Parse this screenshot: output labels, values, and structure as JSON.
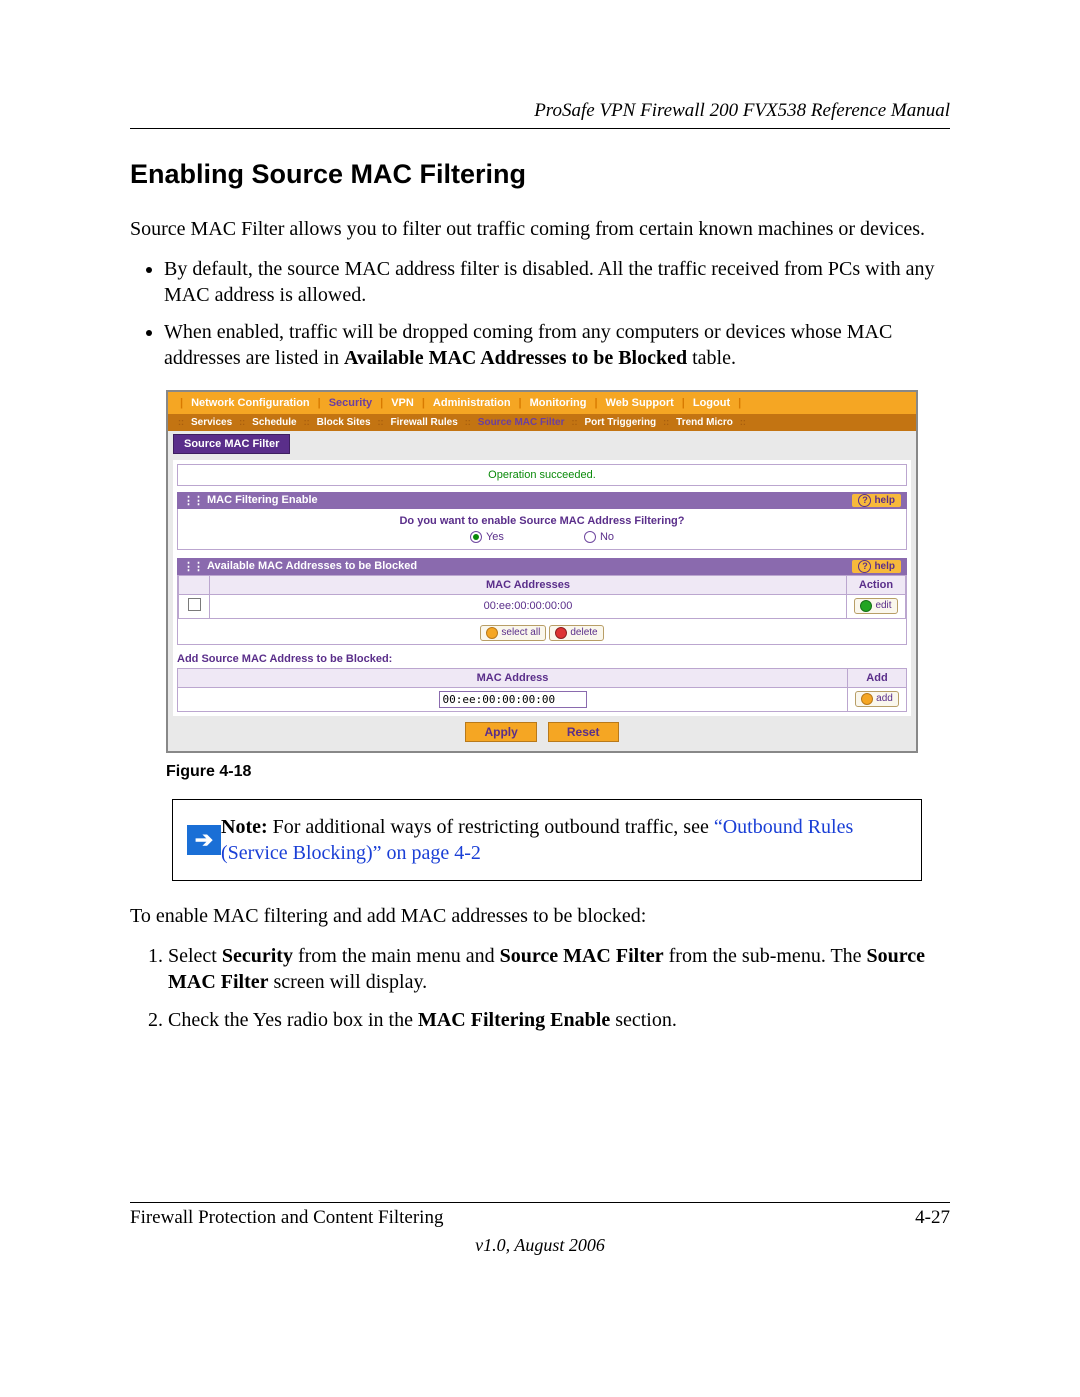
{
  "doc": {
    "running_head": "ProSafe VPN Firewall 200 FVX538 Reference Manual",
    "heading": "Enabling Source MAC Filtering",
    "intro": "Source MAC Filter allows you to filter out traffic coming from certain known machines or devices.",
    "bullets": [
      "By default, the source MAC address filter is disabled. All the traffic received from PCs with any MAC address is allowed.",
      "When enabled, traffic will be dropped coming from any computers or devices whose MAC addresses are listed in <b>Available MAC Addresses to be Blocked</b> table."
    ],
    "figure_caption": "Figure 4-18",
    "note_label": "Note:",
    "note_body": " For additional ways of restricting outbound traffic, see ",
    "note_link": "“Outbound Rules (Service Blocking)” on page 4-2",
    "post_note": "To enable MAC filtering and add MAC addresses to be blocked:",
    "steps": [
      "Select <b>Security</b> from the main menu and <b>Source MAC Filter</b> from the sub-menu. The <b>Source MAC Filter</b> screen will display.",
      "Check the Yes radio box in the <b>MAC Filtering Enable</b> section."
    ],
    "footer_left": "Firewall Protection and Content Filtering",
    "footer_right": "4-27",
    "footer_version": "v1.0, August 2006"
  },
  "ui": {
    "nav": [
      "Network Configuration",
      "Security",
      "VPN",
      "Administration",
      "Monitoring",
      "Web Support",
      "Logout"
    ],
    "nav_selected_index": 1,
    "subnav": [
      "Services",
      "Schedule",
      "Block Sites",
      "Firewall Rules",
      "Source MAC Filter",
      "Port Triggering",
      "Trend Micro"
    ],
    "subnav_selected_index": 4,
    "page_tab": "Source MAC Filter",
    "op_msg": "Operation succeeded.",
    "panel1_title": "MAC Filtering Enable",
    "panel1_question": "Do you want to enable Source MAC Address Filtering?",
    "radio_yes": "Yes",
    "radio_no": "No",
    "radio_selected": "yes",
    "panel2_title": "Available MAC Addresses to be Blocked",
    "col_mac": "MAC Addresses",
    "col_action": "Action",
    "row_mac": "00:ee:00:00:00:00",
    "btn_edit": "edit",
    "btn_select_all": "select all",
    "btn_delete": "delete",
    "add_section_title": "Add Source MAC Address to be Blocked:",
    "col_mac_single": "MAC Address",
    "col_add": "Add",
    "input_value": "00:ee:00:00:00:00",
    "btn_add": "add",
    "btn_apply": "Apply",
    "btn_reset": "Reset",
    "help_label": "help"
  }
}
